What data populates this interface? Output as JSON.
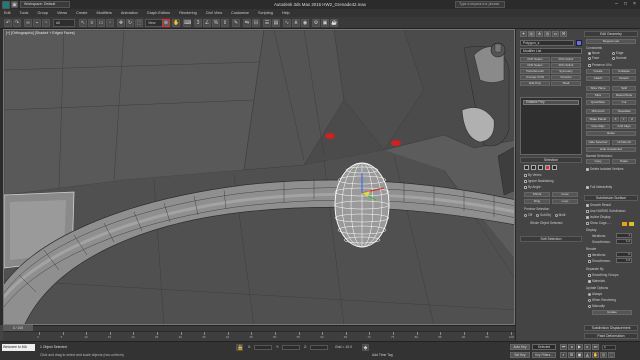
{
  "titlebar": {
    "workspace": "Workspace: Default",
    "title": "Autodesk 3ds Max 2016    HW2_Grenade42.max",
    "search": "Type a keyword or phrase",
    "min": "–",
    "max": "□",
    "close": "×"
  },
  "menu": [
    "Edit",
    "Tools",
    "Group",
    "Views",
    "Create",
    "Modifiers",
    "Animation",
    "Graph Editors",
    "Rendering",
    "Civil View",
    "Customize",
    "Scripting",
    "Help"
  ],
  "toolbar": {
    "selection_filter": "All",
    "view_ref": "View"
  },
  "viewport": {
    "label": "[+] [Orthographic] [Shaded + Edged Faces]"
  },
  "command_panel": {
    "object_name": "Polygon_s",
    "modifier_list": "Modifier List",
    "buttons": [
      "FFD Select",
      "FFD 2x2x2",
      "FFD Select",
      "FFD 3x3x3",
      "TurboSmooth",
      "Symmetry",
      "Unwrap UVW",
      "Chamfer",
      "Edit Poly",
      "Shell"
    ],
    "stack_item": "Editable Poly",
    "selection_rollout": "Selection",
    "selection_rows": [
      "By Vertex",
      "Ignore Backfacing",
      "By Angle:",
      "Shrink",
      "Grow",
      "Ring",
      "Loop"
    ],
    "preview_label": "Preview Selection",
    "preview_opts": [
      "Off",
      "SubObj",
      "Multi"
    ],
    "whole_selected": "Whole Object Selected",
    "soft_selection": "Soft Selection",
    "edit_geometry": "Edit Geometry",
    "repeat_last": "Repeat Last",
    "constraints_label": "Constraints",
    "constraints": [
      "None",
      "Edge",
      "Face",
      "Normal"
    ],
    "preserve_uvs": "Preserve UVs",
    "right_buttons": [
      "Create",
      "Collapse",
      "Attach",
      "Detach",
      "Slice Plane",
      "Split",
      "Slice",
      "Reset Plane",
      "QuickSlice",
      "Cut",
      "MSmooth",
      "Tessellate",
      "Make Planar",
      "X",
      "Y",
      "Z",
      "View Align",
      "Grid Align",
      "Relax",
      "Hide Selected",
      "Unhide All",
      "Hide Unselected",
      "Named Selections:",
      "Copy",
      "Paste"
    ],
    "delete_isolated": "Delete Isolated Vertices",
    "full_interactivity": "Full Interactivity",
    "subdivision_surface": "Subdivision Surface",
    "smooth_result": "Smooth Result",
    "use_nurms": "Use NURMS Subdivision",
    "isoline": "Isoline Display",
    "show_cage": "Show Cage......",
    "display_label": "Display",
    "iterations_label": "Iterations:",
    "iterations_value": "1",
    "smoothness_label": "Smoothness:",
    "smoothness_value": "1.0",
    "render_label": "Render",
    "render_iter": "Iterations:",
    "render_iter_value": "0",
    "render_smooth": "Smoothness:",
    "render_smooth_value": "1.0",
    "separate_by": "Separate By",
    "smoothing_groups": "Smoothing Groups",
    "materials": "Materials",
    "update_options": "Update Options",
    "always": "Always",
    "when_rendering": "When Rendering",
    "manually": "Manually",
    "update": "Update",
    "subdiv_displacement": "Subdivision Displacement",
    "paint_deformation": "Paint Deformation"
  },
  "timeline": {
    "slider": "0 / 100",
    "ticks": [
      "0",
      "5",
      "10",
      "15",
      "20",
      "25",
      "30",
      "35",
      "40",
      "45",
      "50",
      "55",
      "60",
      "65",
      "70",
      "75",
      "80",
      "85",
      "90",
      "95",
      "100"
    ]
  },
  "status": {
    "maxscript": "Welcome to MA",
    "line1": "1 Object Selected",
    "line2": "Click and drag to select and scale objects (non-uniform)",
    "x_label": "X:",
    "y_label": "Y:",
    "z_label": "Z:",
    "grid": "Grid = 10.0",
    "auto_key": "Auto Key",
    "selected": "Selected",
    "set_key": "Set Key",
    "key_filters": "Key Filters...",
    "add_time_tag": "Add Time Tag",
    "frame": "0"
  },
  "colors": {
    "highlight": "#e03030",
    "bg": "#444444"
  }
}
